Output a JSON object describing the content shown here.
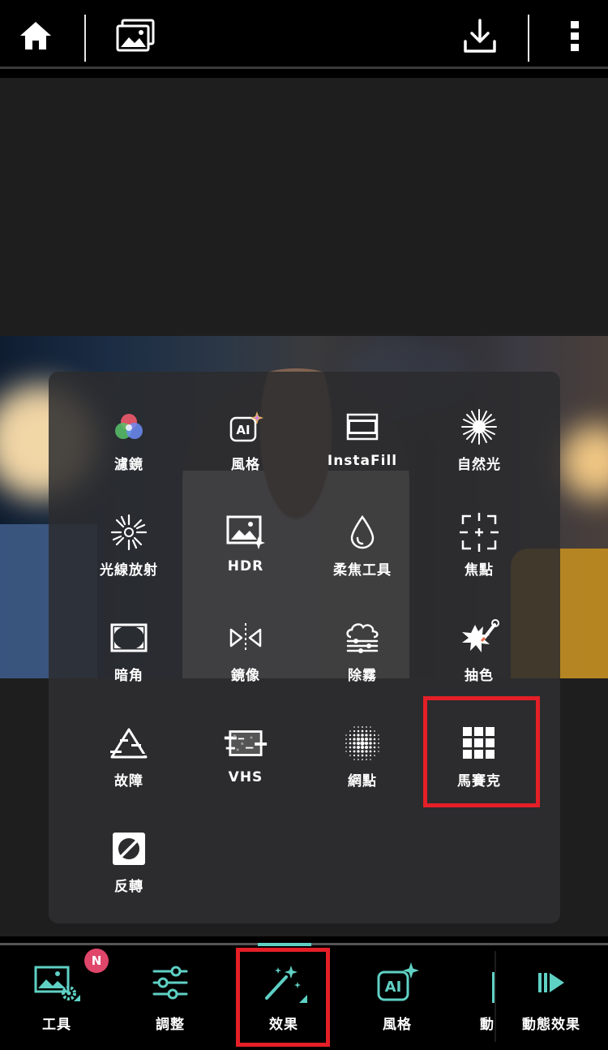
{
  "topbar": {
    "home_icon": "home-icon",
    "gallery_icon": "gallery-icon",
    "download_icon": "download-icon",
    "more_icon": "more-vertical-icon"
  },
  "effects_panel": {
    "tools": [
      {
        "label": "濾鏡",
        "icon": "filter-icon"
      },
      {
        "label": "風格",
        "icon": "ai-style-icon"
      },
      {
        "label": "InstaFill",
        "icon": "instafill-icon"
      },
      {
        "label": "自然光",
        "icon": "natural-light-icon"
      },
      {
        "label": "光線放射",
        "icon": "light-rays-icon"
      },
      {
        "label": "HDR",
        "icon": "hdr-icon"
      },
      {
        "label": "柔焦工具",
        "icon": "soft-focus-icon"
      },
      {
        "label": "焦點",
        "icon": "focus-icon"
      },
      {
        "label": "暗角",
        "icon": "vignette-icon"
      },
      {
        "label": "鏡像",
        "icon": "mirror-icon"
      },
      {
        "label": "除霧",
        "icon": "dehaze-icon"
      },
      {
        "label": "抽色",
        "icon": "color-splash-icon"
      },
      {
        "label": "故障",
        "icon": "glitch-icon"
      },
      {
        "label": "VHS",
        "icon": "vhs-icon"
      },
      {
        "label": "網點",
        "icon": "halftone-icon"
      },
      {
        "label": "馬賽克",
        "icon": "mosaic-icon"
      },
      {
        "label": "反轉",
        "icon": "invert-icon"
      }
    ],
    "highlighted_tool": "馬賽克"
  },
  "bottom_nav": {
    "items": [
      {
        "label": "工具",
        "icon": "tools-icon",
        "badge": "N"
      },
      {
        "label": "調整",
        "icon": "adjust-icon"
      },
      {
        "label": "效果",
        "icon": "effects-wand-icon",
        "active": true
      },
      {
        "label": "風格",
        "icon": "ai-style-icon"
      },
      {
        "label": "動",
        "icon": "partial-icon"
      },
      {
        "label": "動態效果",
        "icon": "motion-effects-icon"
      }
    ]
  },
  "colors": {
    "accent": "#5fd0c4",
    "highlight": "#e41f27",
    "badge": "#e0456a",
    "panel": "#2c2c2e"
  }
}
